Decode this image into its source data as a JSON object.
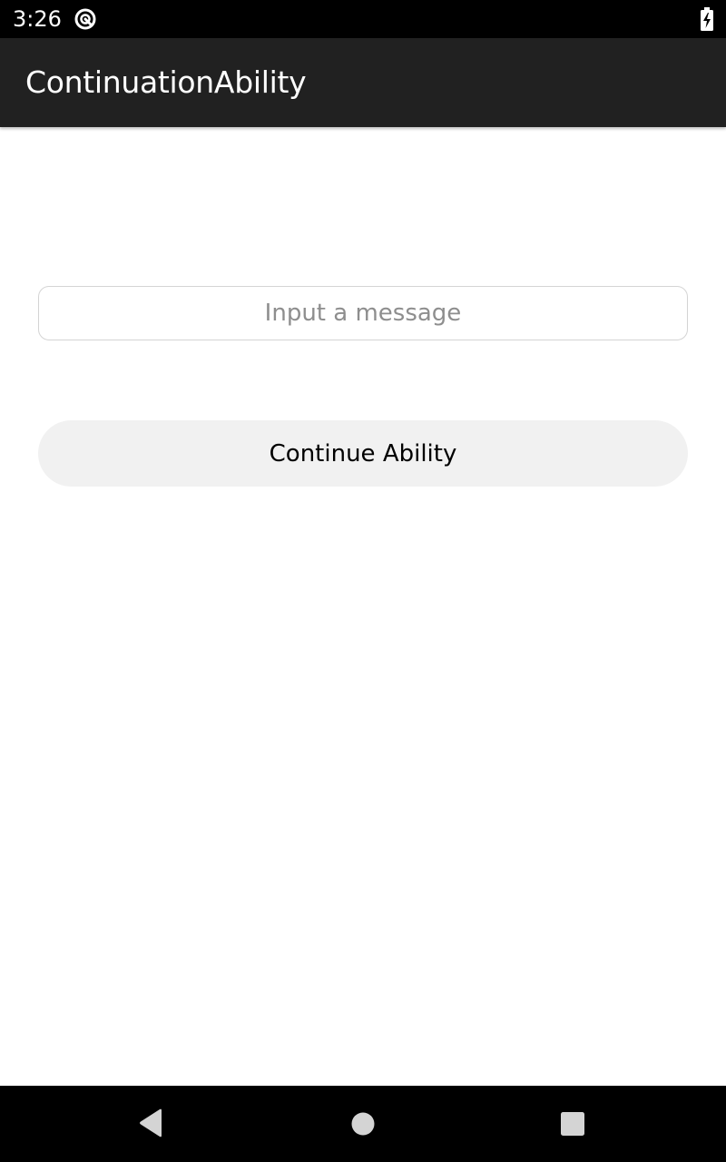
{
  "status_bar": {
    "time": "3:26",
    "icons": [
      "notification-icon",
      "battery-charging-icon"
    ]
  },
  "app_bar": {
    "title": "ContinuationAbility"
  },
  "main": {
    "message_input": {
      "value": "",
      "placeholder": "Input a message"
    },
    "continue_button": {
      "label": "Continue Ability"
    }
  },
  "nav_bar": {
    "icons": [
      "back-icon",
      "home-icon",
      "recents-icon"
    ]
  },
  "colors": {
    "status_bar": "#000000",
    "app_bar": "#212121",
    "background": "#ffffff",
    "button": "#f1f1f1",
    "placeholder": "#8e8e8e"
  }
}
